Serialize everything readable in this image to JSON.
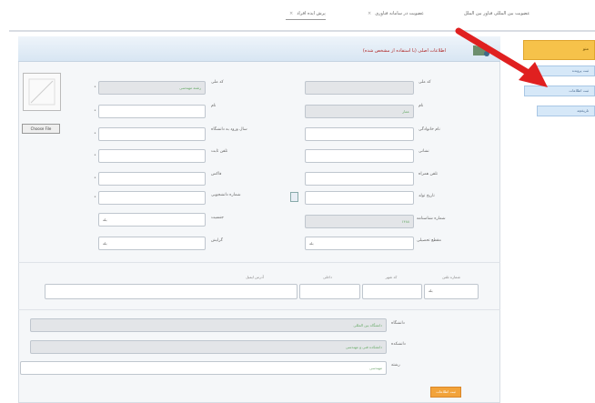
{
  "top_tabs": [
    {
      "label": "پرش ایده افراد"
    },
    {
      "label": "عضویت در سامانه فناوری"
    },
    {
      "label": "عضویت بین المللی فناور بین الملل"
    }
  ],
  "header": {
    "title": "اطلاعات اصلی (با استفاده از مشخص شده)"
  },
  "avatar": {
    "choose_label": "Choose File"
  },
  "form": {
    "right": [
      {
        "label": "کد ملی",
        "value": ""
      },
      {
        "label": "نام",
        "value": "عمار"
      },
      {
        "label": "نام خانوادگی",
        "value": ""
      },
      {
        "label": "نشانی",
        "value": ""
      },
      {
        "label": "تلفن همراه",
        "value": ""
      },
      {
        "label": "تاریخ تولد",
        "value": ""
      },
      {
        "label": "شماره شناسنامه",
        "value": "۱۴۸۸"
      },
      {
        "label": "مقطع تحصیلی",
        "value": "بله"
      }
    ],
    "left": [
      {
        "label": "کد ملی",
        "value": "رشته مهندسی"
      },
      {
        "label": "نام",
        "value": ""
      },
      {
        "label": "سال ورود به دانشگاه",
        "value": ""
      },
      {
        "label": "تلفن ثابت",
        "value": ""
      },
      {
        "label": "فاکس",
        "value": ""
      },
      {
        "label": "شماره دانشجویی",
        "value": ""
      },
      {
        "label": "جنسیت",
        "value": "بله"
      },
      {
        "label": "گرایش",
        "value": "بله"
      }
    ]
  },
  "phone_row": {
    "headers": [
      "شماره تلفن",
      "کد شهر",
      "داخلی",
      "کد کشور",
      "آدرس ایمیل"
    ],
    "country_value": "بله"
  },
  "bottom": [
    {
      "label": "دانشگاه",
      "value": "دانشگاه بین المللی"
    },
    {
      "label": "دانشکده",
      "value": "دانشکده فنی و مهندسی"
    },
    {
      "label": "رشته",
      "value": "مهندسی"
    }
  ],
  "save_label": "ثبت اطلاعات",
  "side_menu": {
    "head": "منو",
    "items": [
      "ثبت پرونده",
      "ثبت اطلاعات",
      "تاریخچه"
    ]
  },
  "colors": {
    "accent": "#f6c24a",
    "arrow": "#e02020",
    "header_title": "#b02a2a"
  }
}
